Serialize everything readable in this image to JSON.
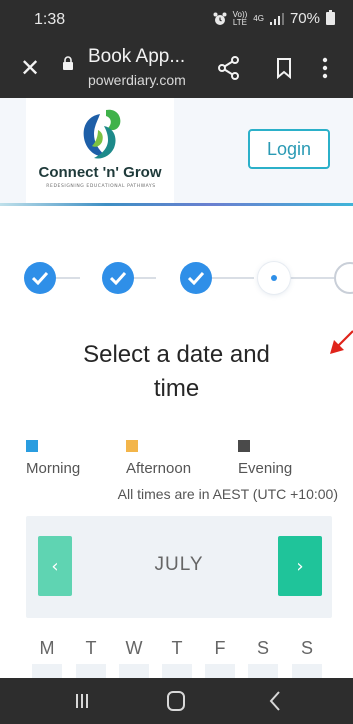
{
  "status_bar": {
    "time": "1:38",
    "network_top": "Vo))",
    "network_bottom": "LTE",
    "network_type": "4G",
    "battery": "70%",
    "icons": [
      "alarm-icon",
      "signal-icon",
      "battery-icon"
    ]
  },
  "browser": {
    "page_title": "Book App...",
    "url": "powerdiary.com",
    "close_icon": "close-icon",
    "lock_icon": "lock-icon",
    "share_icon": "share-icon",
    "bookmark_icon": "bookmark-icon",
    "menu_icon": "more-vert-icon"
  },
  "site": {
    "brand_name": "Connect 'n' Grow",
    "brand_tagline": "REDESIGNING EDUCATIONAL PATHWAYS",
    "login_label": "Login",
    "accent_color": "#2bb0c9"
  },
  "steps": {
    "total": 5,
    "completed": 3,
    "current": 4,
    "done_color": "#2f8fe8"
  },
  "heading": {
    "line1": "Select a date and",
    "line2": "time"
  },
  "legend": {
    "items": [
      {
        "label": "Morning",
        "color": "#2a9de0"
      },
      {
        "label": "Afternoon",
        "color": "#f3b54a"
      },
      {
        "label": "Evening",
        "color": "#4a4a4a"
      }
    ],
    "timezone_note": "All times are in AEST (UTC +10:00)"
  },
  "calendar": {
    "month": "JULY",
    "prev_label": "‹",
    "next_label": "›",
    "weekdays": [
      "M",
      "T",
      "W",
      "T",
      "F",
      "S",
      "S"
    ]
  },
  "nav_bar": {
    "icons": [
      "recents-icon",
      "home-icon",
      "back-icon"
    ]
  }
}
